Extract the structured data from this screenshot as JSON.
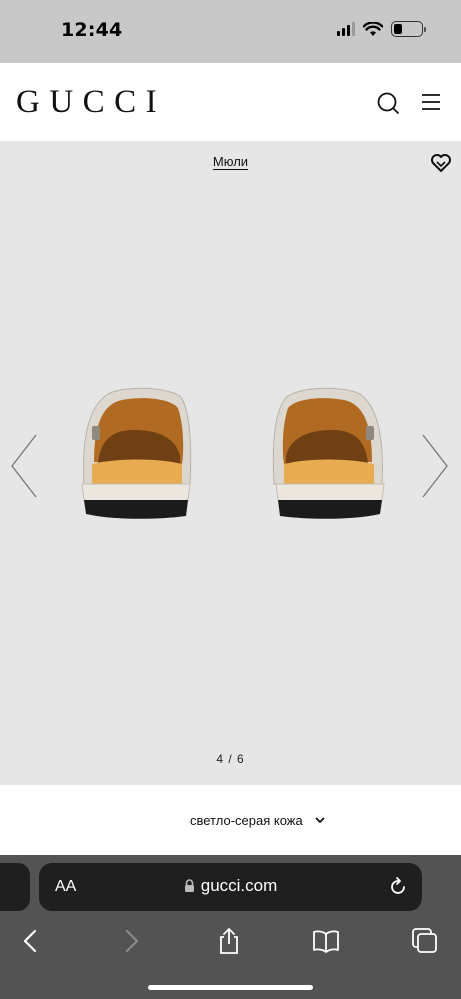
{
  "status_bar": {
    "time": "12:44",
    "icons": [
      "signal-icon",
      "wifi-icon",
      "battery-icon"
    ]
  },
  "header": {
    "logo": "GUCCI",
    "icons": [
      "search-icon",
      "menu-icon"
    ]
  },
  "gallery": {
    "category": "Мюли",
    "pager": "4 / 6",
    "background": "#e6e6e6"
  },
  "color_selector": {
    "selected": "светло-серая кожа"
  },
  "browser": {
    "text_size_label": "AA",
    "url": "gucci.com",
    "toolbar": [
      "back-icon",
      "forward-icon",
      "share-icon",
      "bookmarks-icon",
      "tabs-icon"
    ]
  }
}
